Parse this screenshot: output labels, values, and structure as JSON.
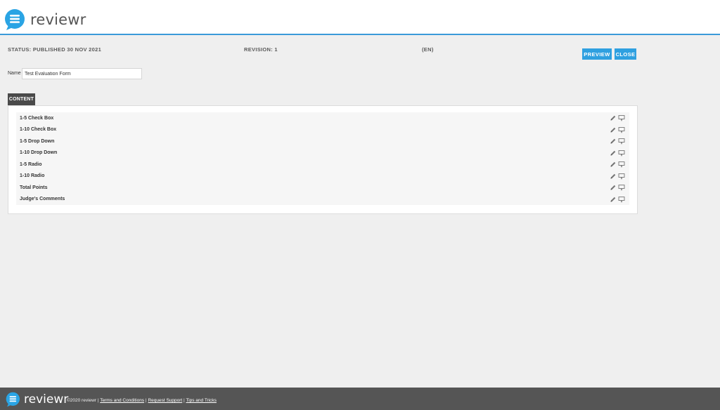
{
  "brand": {
    "name": "reviewr",
    "accent": "#2fa0e0"
  },
  "header": {
    "status": "STATUS: PUBLISHED 30 NOV 2021",
    "revision": "REVISION: 1",
    "language": "(EN)",
    "preview_label": "PREVIEW",
    "close_label": "CLOSE"
  },
  "form": {
    "name_label": "Name",
    "name_value": "Test Evaluation Form"
  },
  "content": {
    "tab_label": "CONTENT",
    "items": [
      {
        "label": "1-5 Check Box"
      },
      {
        "label": "1-10 Check Box"
      },
      {
        "label": "1-5 Drop Down"
      },
      {
        "label": "1-10 Drop Down"
      },
      {
        "label": "1-5 Radio"
      },
      {
        "label": "1-10 Radio"
      },
      {
        "label": "Total Points"
      },
      {
        "label": "Judge's Comments"
      }
    ],
    "icons": [
      "pencil-icon",
      "comment-icon"
    ]
  },
  "footer": {
    "brand": "reviewr",
    "copyright": "©2020 reviewr",
    "links": [
      "Terms and Conditions",
      "Request Support",
      "Tips and Tricks"
    ],
    "separator": "|"
  }
}
